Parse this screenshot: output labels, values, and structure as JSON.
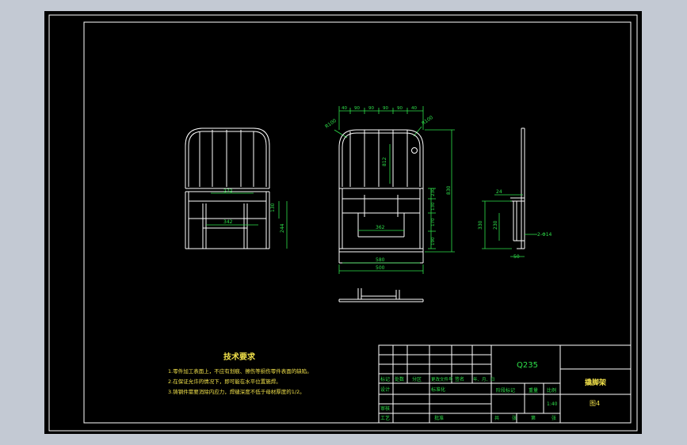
{
  "drawing": {
    "tech_title": "技术要求",
    "notes": [
      "1.零件加工表面上，不应有划痕、擦伤等损伤零件表面的缺陷。",
      "2.在保证允许的情况下，即可能在水平位置施焊。",
      "3.铸钢件需要消除内应力，焊缝深度不低于母材厚度的1/2。"
    ],
    "dims_front": [
      "40",
      "90",
      "90",
      "90",
      "90",
      "40",
      "R100",
      "R100",
      "812",
      "230",
      "130",
      "170",
      "190",
      "830",
      "362",
      "580",
      "500"
    ],
    "dims_left": [
      "272",
      "342",
      "130",
      "244"
    ],
    "dims_side": [
      "24",
      "330",
      "230",
      "2-Φ14",
      "50"
    ]
  },
  "title_block": {
    "material": "Q235",
    "part_name": "撬脚架",
    "drawing_no": "图4",
    "scale": "1:40",
    "row_headers": [
      "标记",
      "处数",
      "分区",
      "更改文件号",
      "签名",
      "年、月、日"
    ],
    "labels": {
      "design": "设计",
      "standardize": "标准化",
      "stage_mark": "阶段标记",
      "weight": "重量",
      "scale_label": "比例",
      "review": "审核",
      "process": "工艺",
      "approve": "批准",
      "total": "共",
      "sheets": "张",
      "number": "第",
      "sheet": "张"
    }
  }
}
